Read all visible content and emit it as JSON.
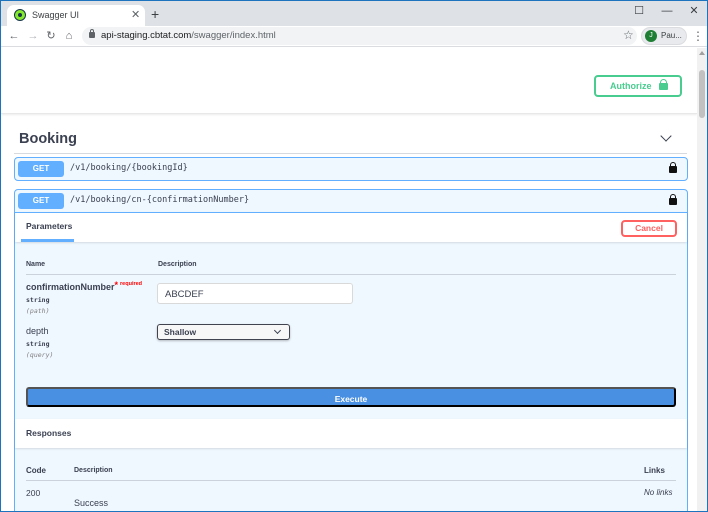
{
  "browser": {
    "tab_title": "Swagger UI",
    "tab_close": "✕",
    "new_tab": "+",
    "url_host": "api-staging.cbtat.com",
    "url_path": "/swagger/index.html",
    "profile_initial": "J",
    "profile_name": "Pau...",
    "window_controls": {
      "minimize": "—",
      "maximize": "☐",
      "close": "✕"
    },
    "nav": {
      "back": "←",
      "forward": "→",
      "reload": "↻",
      "home": "⌂",
      "star": "☆",
      "menu": "⋮"
    }
  },
  "auth": {
    "authorize_label": "Authorize"
  },
  "section": {
    "title": "Booking"
  },
  "operations": [
    {
      "method": "GET",
      "path": "/v1/booking/{bookingId}"
    },
    {
      "method": "GET",
      "path": "/v1/booking/cn-{confirmationNumber}"
    }
  ],
  "expanded_operation": {
    "params_tab_label": "Parameters",
    "cancel_label": "Cancel",
    "columns": {
      "name": "Name",
      "description": "Description"
    },
    "parameters": [
      {
        "name": "confirmationNumber",
        "required_star": "*",
        "required_text": "required",
        "type": "string",
        "in": "(path)",
        "value": "ABCDEF"
      },
      {
        "name": "depth",
        "type": "string",
        "in": "(query)",
        "selected": "Shallow"
      }
    ],
    "execute_label": "Execute",
    "responses_title": "Responses",
    "response_columns": {
      "code": "Code",
      "description": "Description",
      "links": "Links"
    },
    "responses": [
      {
        "code": "200",
        "description": "Success",
        "links": "No links"
      }
    ]
  },
  "colors": {
    "get_method": "#61affe",
    "authorize": "#49cc90",
    "cancel": "#ff6060",
    "execute": "#4990e2",
    "text": "#3b4151"
  }
}
